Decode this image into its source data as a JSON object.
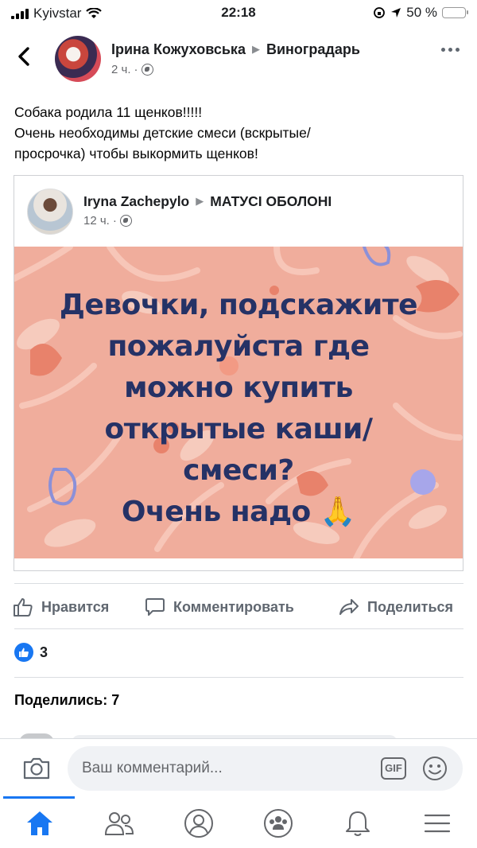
{
  "status_bar": {
    "carrier": "Kyivstar",
    "time": "22:18",
    "battery": "50 %"
  },
  "post": {
    "author": "Ірина Кожуховська",
    "group": "Виноградарь",
    "time": "2 ч.",
    "text_line1": "Собака родила 11 щенков!!!!!",
    "text_line2": "Очень необходимы детские смеси (вскрытые/",
    "text_line3": "просрочка) чтобы выкормить щенков!"
  },
  "shared_post": {
    "author": "Iryna Zachepylo",
    "group": "МАТУСІ ОБОЛОНІ",
    "time": "12 ч.",
    "image_text": {
      "line1": "Девочки, подскажите",
      "line2": "пожалуйста где",
      "line3": "можно купить",
      "line4": "открытые каши/",
      "line5": "смеси?",
      "line6": "Очень надо 🙏"
    }
  },
  "actions": {
    "like": "Нравится",
    "comment": "Комментировать",
    "share": "Поделиться"
  },
  "reactions": {
    "count": "3"
  },
  "shares_text": "Поделились: 7",
  "composer": {
    "placeholder": "Ваш комментарий...",
    "gif_label": "GIF"
  },
  "colors": {
    "accent": "#1877f2",
    "banner_bg": "#f0ad9c",
    "banner_text": "#253266"
  },
  "icons": [
    "back-chevron-icon",
    "globe-icon",
    "more-icon",
    "like-icon",
    "comment-icon",
    "share-icon",
    "camera-icon",
    "gif-icon",
    "smiley-icon",
    "home-icon",
    "friends-icon",
    "profile-icon",
    "groups-icon",
    "notifications-icon",
    "menu-icon"
  ]
}
